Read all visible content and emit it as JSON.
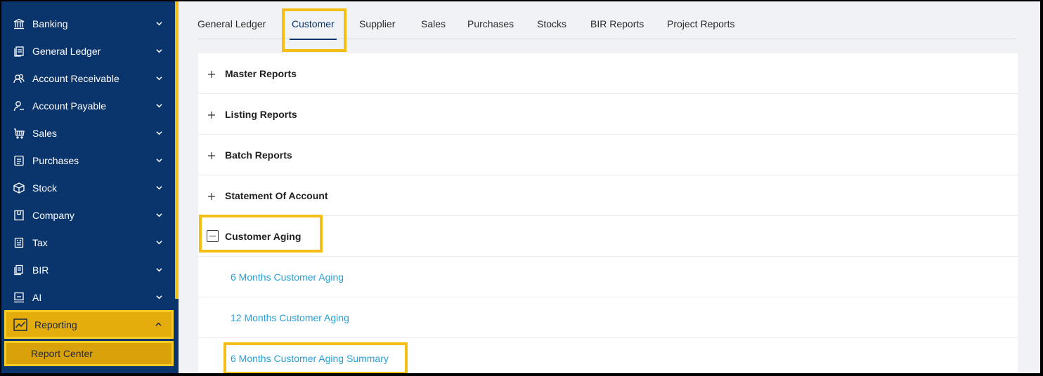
{
  "sidebar": {
    "items": [
      {
        "label": "Banking",
        "icon": "bank-icon"
      },
      {
        "label": "General Ledger",
        "icon": "ledger-icon"
      },
      {
        "label": "Account Receivable",
        "icon": "receivable-icon"
      },
      {
        "label": "Account Payable",
        "icon": "payable-icon"
      },
      {
        "label": "Sales",
        "icon": "cart-icon"
      },
      {
        "label": "Purchases",
        "icon": "purchases-icon"
      },
      {
        "label": "Stock",
        "icon": "box-icon"
      },
      {
        "label": "Company",
        "icon": "company-icon"
      },
      {
        "label": "Tax",
        "icon": "tax-icon"
      },
      {
        "label": "BIR",
        "icon": "bir-icon"
      },
      {
        "label": "AI",
        "icon": "ai-icon"
      }
    ],
    "reporting": {
      "label": "Reporting",
      "icon": "chart-line-icon"
    },
    "report_center": "Report Center"
  },
  "tabs": [
    "General Ledger",
    "Customer",
    "Supplier",
    "Sales",
    "Purchases",
    "Stocks",
    "BIR Reports",
    "Project Reports"
  ],
  "active_tab": "Customer",
  "sections": [
    {
      "title": "Master Reports",
      "expanded": false
    },
    {
      "title": "Listing Reports",
      "expanded": false
    },
    {
      "title": "Batch Reports",
      "expanded": false
    },
    {
      "title": "Statement Of Account",
      "expanded": false
    },
    {
      "title": "Customer Aging",
      "expanded": true
    }
  ],
  "customer_aging_links": [
    "6 Months Customer Aging",
    "12 Months Customer Aging",
    "6 Months Customer Aging Summary"
  ],
  "colors": {
    "sidebar_bg": "#0a356c",
    "highlight": "#f3bf16",
    "link": "#26a0da",
    "active_tab": "#0a356c"
  }
}
